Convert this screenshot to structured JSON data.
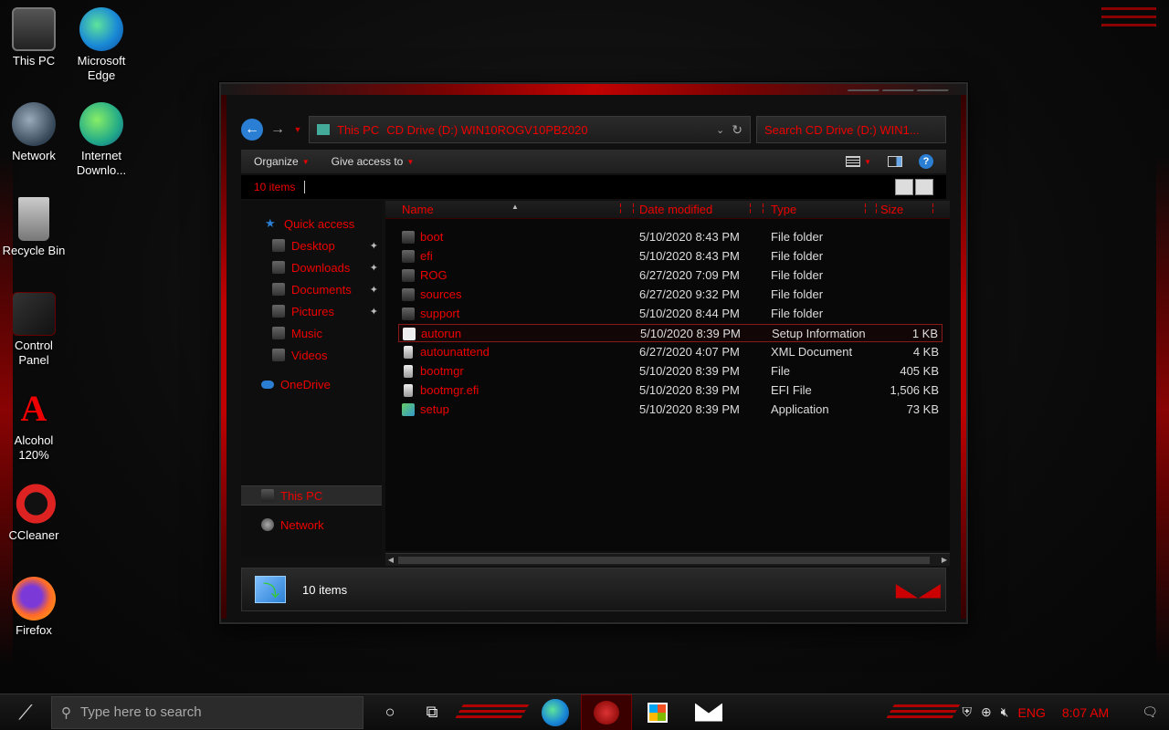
{
  "desktop": {
    "icons": [
      {
        "label": "This PC"
      },
      {
        "label": "Microsoft Edge"
      },
      {
        "label": "Network"
      },
      {
        "label": "Internet Downlo..."
      },
      {
        "label": "Recycle Bin"
      },
      {
        "label": "Control Panel"
      },
      {
        "label": "Alcohol 120%"
      },
      {
        "label": "CCleaner"
      },
      {
        "label": "Firefox"
      }
    ]
  },
  "explorer": {
    "address": {
      "segments": [
        "This PC",
        "CD Drive (D:) WIN10ROGV10PB2020"
      ]
    },
    "search_placeholder": "Search CD Drive (D:) WIN1...",
    "toolbar": {
      "organize": "Organize",
      "give_access": "Give access to"
    },
    "item_count_top": "10 items",
    "nav": [
      {
        "label": "Quick access",
        "pinned": false
      },
      {
        "label": "Desktop",
        "pinned": true
      },
      {
        "label": "Downloads",
        "pinned": true
      },
      {
        "label": "Documents",
        "pinned": true
      },
      {
        "label": "Pictures",
        "pinned": true
      },
      {
        "label": "Music",
        "pinned": false
      },
      {
        "label": "Videos",
        "pinned": false
      },
      {
        "label": "OneDrive",
        "pinned": false
      },
      {
        "label": "This PC",
        "pinned": false
      },
      {
        "label": "Network",
        "pinned": false
      }
    ],
    "columns": {
      "name": "Name",
      "date": "Date modified",
      "type": "Type",
      "size": "Size"
    },
    "files": [
      {
        "name": "boot",
        "date": "5/10/2020 8:43 PM",
        "type": "File folder",
        "size": ""
      },
      {
        "name": "efi",
        "date": "5/10/2020 8:43 PM",
        "type": "File folder",
        "size": ""
      },
      {
        "name": "ROG",
        "date": "6/27/2020 7:09 PM",
        "type": "File folder",
        "size": ""
      },
      {
        "name": "sources",
        "date": "6/27/2020 9:32 PM",
        "type": "File folder",
        "size": ""
      },
      {
        "name": "support",
        "date": "5/10/2020 8:44 PM",
        "type": "File folder",
        "size": ""
      },
      {
        "name": "autorun",
        "date": "5/10/2020 8:39 PM",
        "type": "Setup Information",
        "size": "1 KB"
      },
      {
        "name": "autounattend",
        "date": "6/27/2020 4:07 PM",
        "type": "XML Document",
        "size": "4 KB"
      },
      {
        "name": "bootmgr",
        "date": "5/10/2020 8:39 PM",
        "type": "File",
        "size": "405 KB"
      },
      {
        "name": "bootmgr.efi",
        "date": "5/10/2020 8:39 PM",
        "type": "EFI File",
        "size": "1,506 KB"
      },
      {
        "name": "setup",
        "date": "5/10/2020 8:39 PM",
        "type": "Application",
        "size": "73 KB"
      }
    ],
    "status_text": "10 items"
  },
  "taskbar": {
    "search_placeholder": "Type here to search",
    "lang": "ENG",
    "time": "8:07 AM"
  }
}
